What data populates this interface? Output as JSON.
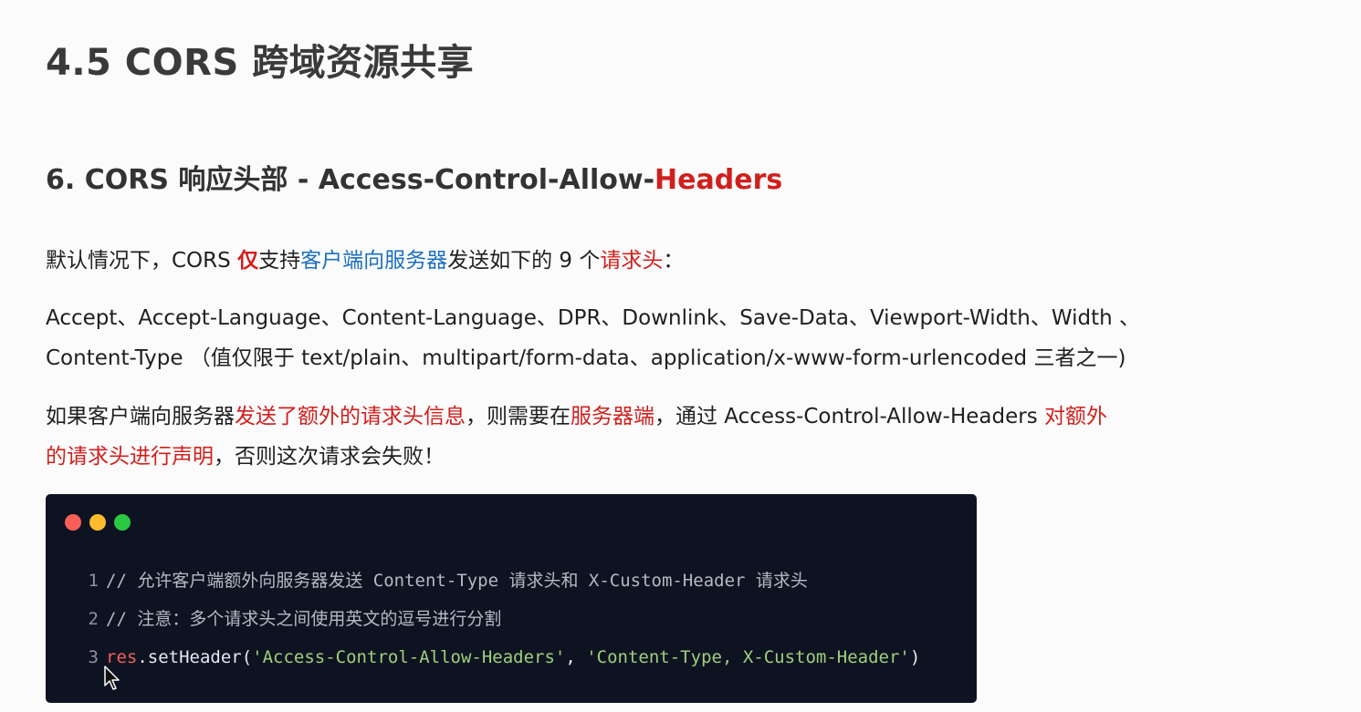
{
  "page_title": "4.5 CORS 跨域资源共享",
  "section_title": {
    "prefix": "6. CORS 响应头部 - Access-Control-Allow-",
    "highlight": "Headers"
  },
  "para1": {
    "t1": "默认情况下，CORS ",
    "t2": "仅",
    "t3": "支持",
    "t4": "客户端向服务器",
    "t5": "发送如下的 9 个",
    "t6": "请求头",
    "t7": "："
  },
  "para2": {
    "line1": "Accept、Accept-Language、Content-Language、DPR、Downlink、Save-Data、Viewport-Width、Width 、",
    "line2": "Content-Type （值仅限于 text/plain、multipart/form-data、application/x-www-form-urlencoded 三者之一)"
  },
  "para3": {
    "t1": "如果客户端向服务器",
    "t2": "发送了额外的请求头信息",
    "t3": "，则需要在",
    "t4": "服务器端",
    "t5": "，通过 Access-Control-Allow-Headers ",
    "t6": "对额外",
    "t7": "的请求头进行声明",
    "t8": "，否则这次请求会失败！"
  },
  "code": {
    "lines": [
      {
        "num": "1",
        "comment": "// 允许客户端额外向服务器发送 Content-Type 请求头和 X-Custom-Header 请求头"
      },
      {
        "num": "2",
        "comment": "// 注意：多个请求头之间使用英文的逗号进行分割"
      },
      {
        "num": "3",
        "obj": "res",
        "method": ".setHeader(",
        "arg1": "'Access-Control-Allow-Headers'",
        "sep": ", ",
        "arg2": "'Content-Type, X-Custom-Header'",
        "close": ")"
      }
    ]
  },
  "colors": {
    "accent_red": "#d0201d",
    "accent_blue": "#1b6fc0",
    "code_bg": "#0e1322"
  }
}
